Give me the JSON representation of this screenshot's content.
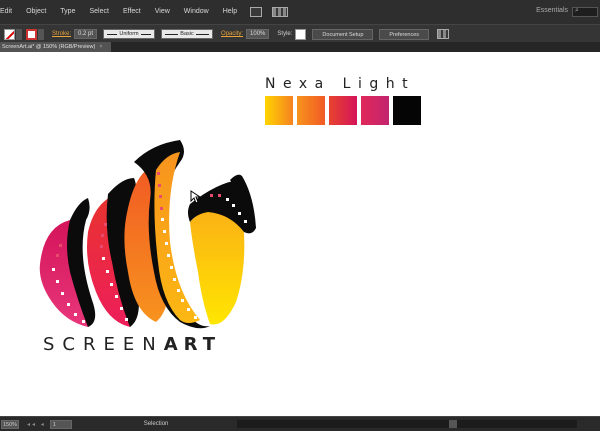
{
  "menubar": {
    "items": [
      "Edit",
      "Object",
      "Type",
      "Select",
      "Effect",
      "View",
      "Window",
      "Help"
    ],
    "workspace": "Essentials",
    "search_glyph": "⌕"
  },
  "controlbar": {
    "stroke_label": "Stroke:",
    "stroke_value": "0.2 pt",
    "profile_value": "Uniform",
    "brush_value": "Basic",
    "opacity_label": "Opacity:",
    "opacity_value": "100%",
    "style_label": "Style:",
    "document_setup": "Document Setup",
    "preferences": "Preferences"
  },
  "document": {
    "tab_title": "ScreenArt.ai* @ 150% (RGB/Preview)",
    "tab_close": "×"
  },
  "artwork": {
    "palette_title": "Nexa Light",
    "swatches": [
      {
        "name": "gradient-yellow-orange",
        "from": "#ffd400",
        "to": "#f58220"
      },
      {
        "name": "gradient-orange",
        "from": "#f7941d",
        "to": "#f15a24"
      },
      {
        "name": "gradient-red",
        "from": "#e8442e",
        "to": "#d4145a"
      },
      {
        "name": "gradient-pink",
        "from": "#e0285a",
        "to": "#c2246e"
      },
      {
        "name": "black",
        "from": "#050505",
        "to": "#050505"
      }
    ],
    "logo_light": "SCREEN",
    "logo_bold": "ART"
  },
  "statusbar": {
    "zoom": "150%",
    "nav_arrows": "◂◂ ◂",
    "page": "1",
    "tool": "Selection"
  }
}
